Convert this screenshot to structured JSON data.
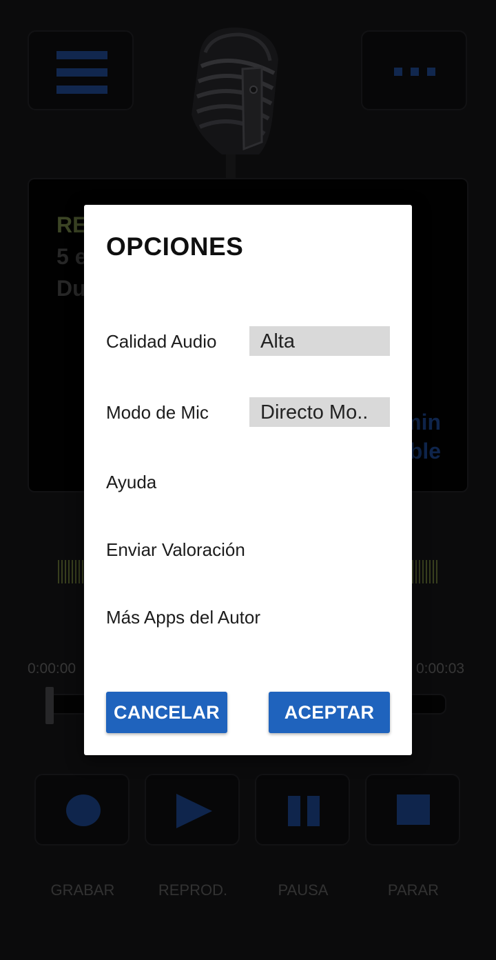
{
  "app": {
    "display": {
      "line1": "RE",
      "line2": "5 e",
      "line3": "Du",
      "right1": "min",
      "right2": "ble"
    },
    "time_start": "0:00:00",
    "time_end": "0:00:03",
    "controls": [
      {
        "label": "GRABAR",
        "icon": "record-icon"
      },
      {
        "label": "REPROD.",
        "icon": "play-icon"
      },
      {
        "label": "PAUSA",
        "icon": "pause-icon"
      },
      {
        "label": "PARAR",
        "icon": "stop-icon"
      }
    ],
    "icons": {
      "menu": "hamburger-menu-icon",
      "more": "more-dots-icon",
      "logo": "microphone-logo"
    },
    "colors": {
      "accent": "#1f63bd",
      "icon_blue": "#173a75",
      "level_green": "#56612e",
      "background": "#111113"
    }
  },
  "dialog": {
    "title": "OPCIONES",
    "options": [
      {
        "label": "Calidad Audio",
        "value": "Alta"
      },
      {
        "label": "Modo de Mic",
        "value": "Directo Mo.."
      },
      {
        "label": "Ayuda"
      },
      {
        "label": "Enviar Valoración"
      },
      {
        "label": "Más Apps del Autor"
      }
    ],
    "cancel_label": "CANCELAR",
    "accept_label": "ACEPTAR"
  }
}
